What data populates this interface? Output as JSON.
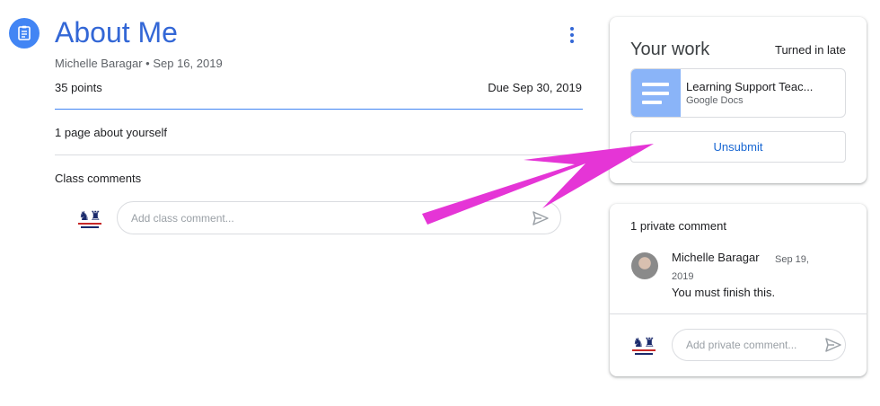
{
  "assignment": {
    "title": "About Me",
    "author": "Michelle Baragar",
    "posted": "Sep 16, 2019",
    "meta_separator": " • ",
    "points": "35 points",
    "due": "Due Sep 30, 2019",
    "description": "1 page about yourself",
    "class_comments_label": "Class comments",
    "class_comment_placeholder": "Add class comment..."
  },
  "your_work": {
    "title": "Your work",
    "status": "Turned in late",
    "attachment": {
      "name": "Learning Support Teac...",
      "type": "Google Docs"
    },
    "unsubmit_label": "Unsubmit"
  },
  "private_comments": {
    "title": "1 private comment",
    "comments": [
      {
        "author": "Michelle Baragar",
        "date_part1": "Sep 19,",
        "date_part2": "2019",
        "text": "You must finish this."
      }
    ],
    "placeholder": "Add private comment..."
  },
  "icons": {
    "assignment": "assignment-icon",
    "more": "more-vert-icon",
    "send": "send-icon",
    "doc": "google-docs-icon",
    "school_logo": "school-logo-avatar"
  },
  "colors": {
    "accent": "#3367d6",
    "primary_blue": "#4285f4",
    "link_blue": "#1967d2",
    "doc_thumb": "#8ab4f8",
    "annotation_arrow": "#e535d6"
  }
}
